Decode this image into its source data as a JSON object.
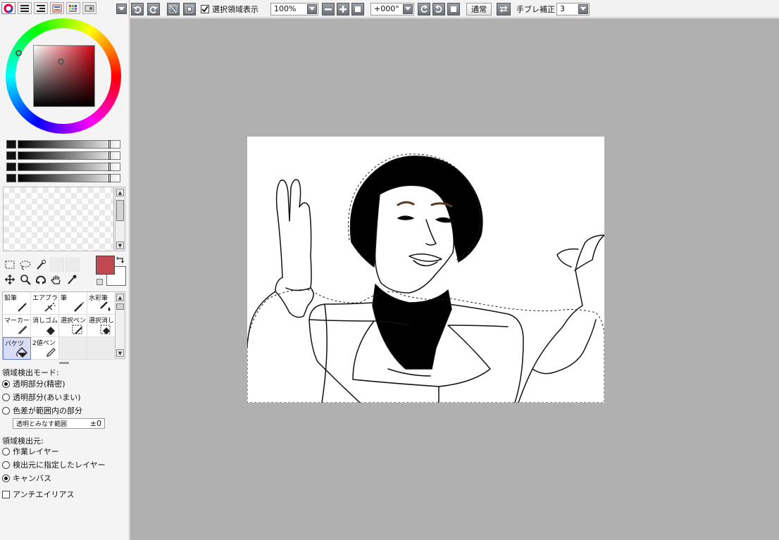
{
  "toolbar": {
    "selection_display_label": "選択領域表示",
    "zoom": "100%",
    "rotation": "+000°",
    "blend_mode": "通常",
    "stabilizer_label": "手ブレ補正",
    "stabilizer_value": "3"
  },
  "color": {
    "foreground": "#c04a52",
    "background": "#ffffff"
  },
  "brushes": [
    {
      "label": "鉛筆",
      "icon": "pencil-icon"
    },
    {
      "label": "エアブラシ",
      "icon": "airbrush-icon"
    },
    {
      "label": "筆",
      "icon": "brush-icon"
    },
    {
      "label": "水彩筆",
      "icon": "watercolor-icon"
    },
    {
      "label": "マーカー",
      "icon": "marker-icon"
    },
    {
      "label": "消しゴム",
      "icon": "eraser-icon"
    },
    {
      "label": "選択ペン",
      "icon": "select-pen-icon"
    },
    {
      "label": "選択消し",
      "icon": "select-erase-icon"
    },
    {
      "label": "バケツ",
      "icon": "bucket-icon"
    },
    {
      "label": "2値ペン",
      "icon": "binary-pen-icon"
    }
  ],
  "detect_mode": {
    "title": "領域検出モード:",
    "options": [
      "透明部分(精密)",
      "透明部分(あいまい)",
      "色差が範囲内の部分"
    ],
    "selected": 0
  },
  "tolerance": {
    "label": "透明とみなす範囲",
    "value": "±0"
  },
  "detect_source": {
    "title": "領域検出元:",
    "options": [
      "作業レイヤー",
      "検出元に指定したレイヤー",
      "キャンバス"
    ],
    "selected": 2
  },
  "antialias_label": "アンチエイリアス"
}
